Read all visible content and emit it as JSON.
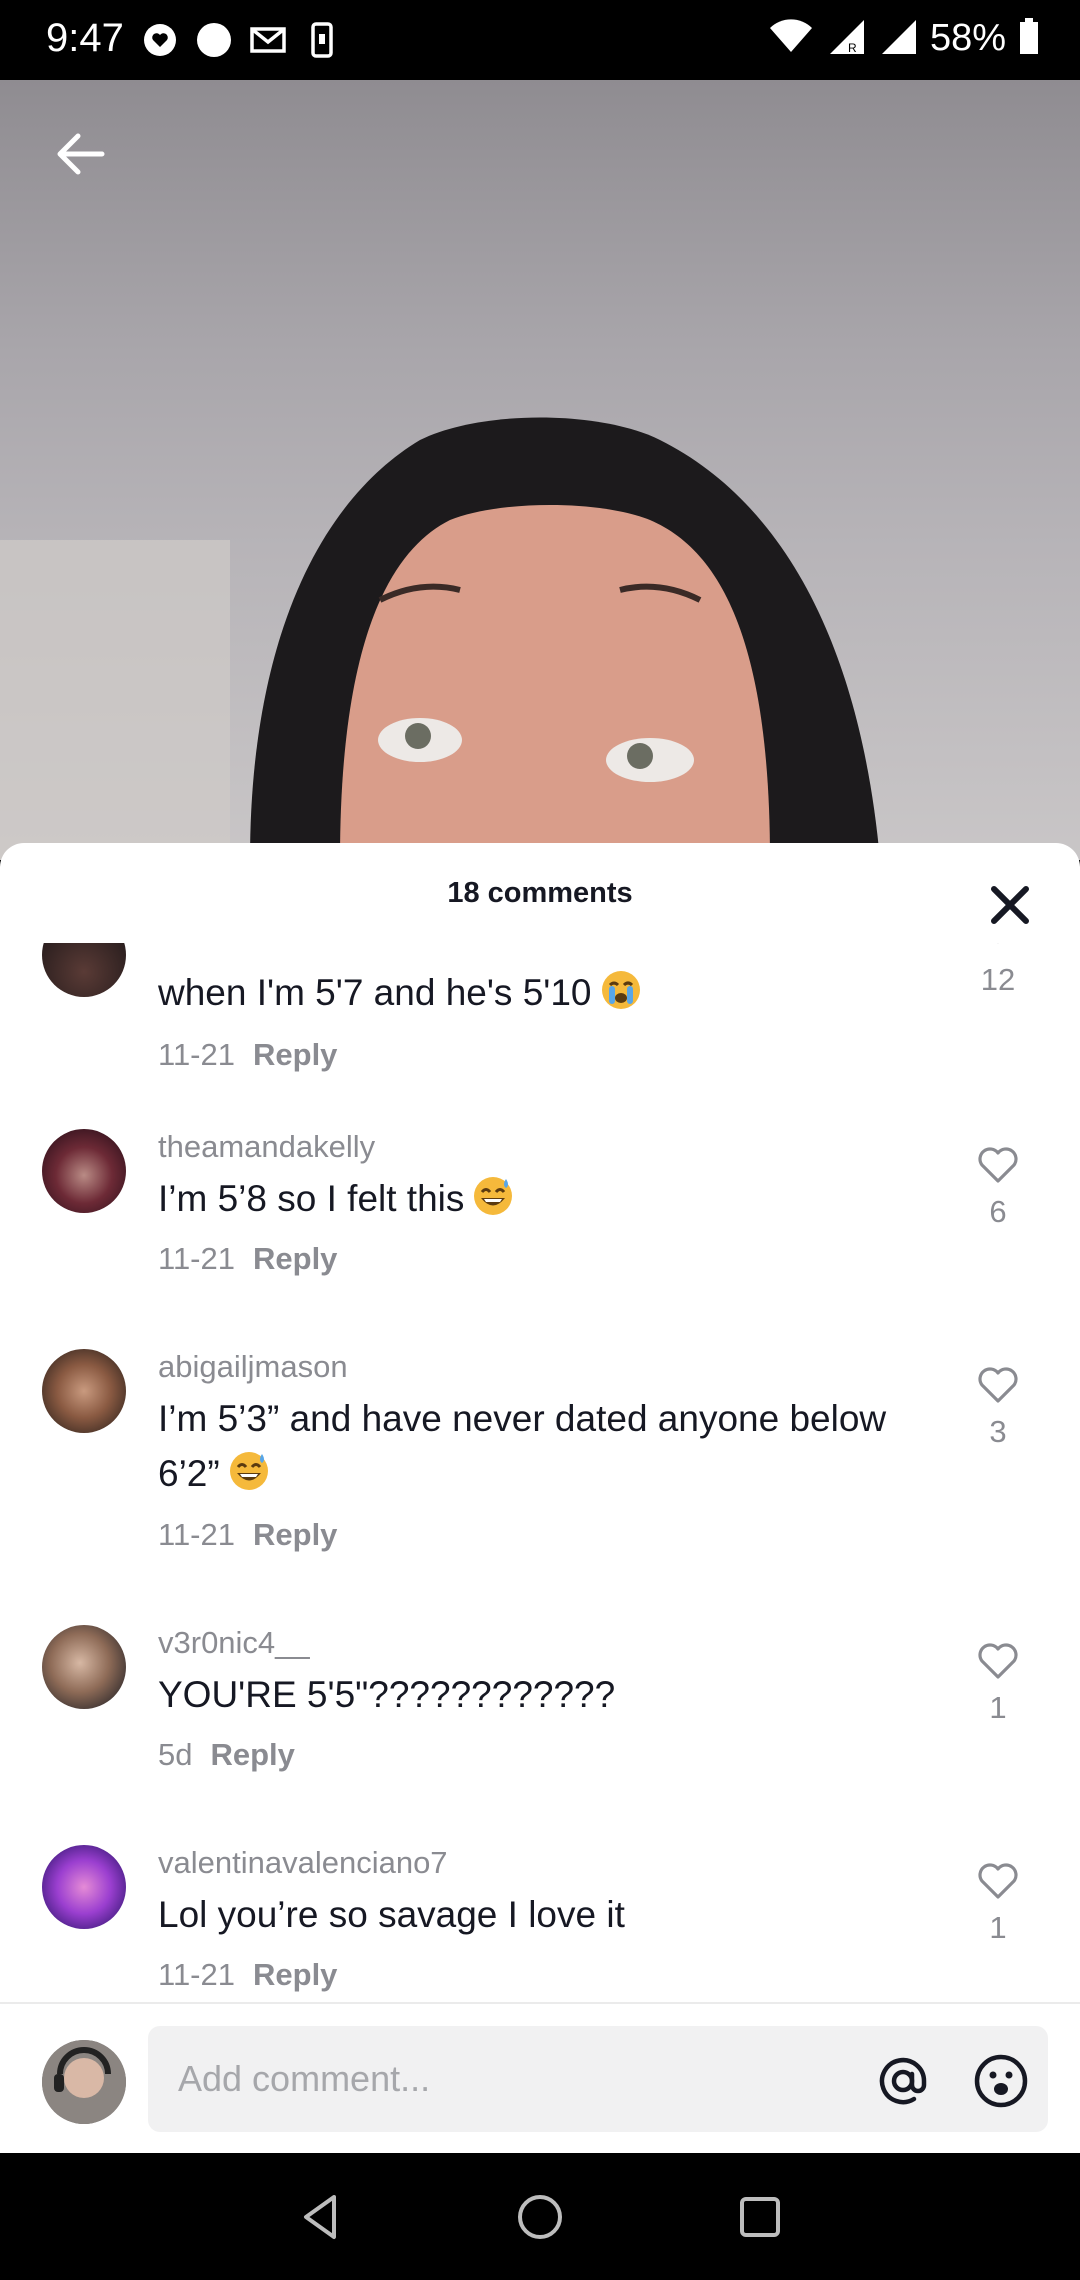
{
  "status_bar": {
    "time": "9:47",
    "battery_percent": "58%",
    "left_icons": [
      "heart-bubble-icon",
      "circle-icon",
      "gmail-icon",
      "phone-icon"
    ],
    "right_icons": [
      "wifi-icon",
      "signal-roaming-icon",
      "signal-icon",
      "battery-icon"
    ]
  },
  "video": {
    "back_icon": "arrow-left-icon"
  },
  "comments_sheet": {
    "title": "18 comments",
    "close_icon": "close-icon",
    "comments": [
      {
        "username": "",
        "text": "when I'm 5'7 and he's 5'10",
        "emoji": "loudly-crying-face",
        "date": "11-21",
        "reply_label": "Reply",
        "likes": "12",
        "like_icon": "chevron-down-icon"
      },
      {
        "username": "theamandakelly",
        "text": "I’m 5’8 so I felt this",
        "emoji": "grinning-sweat-face",
        "date": "11-21",
        "reply_label": "Reply",
        "likes": "6",
        "like_icon": "heart-outline-icon"
      },
      {
        "username": "abigailjmason",
        "text": "I’m 5’3” and have never dated anyone below 6’2”",
        "emoji": "grinning-sweat-face",
        "date": "11-21",
        "reply_label": "Reply",
        "likes": "3",
        "like_icon": "heart-outline-icon"
      },
      {
        "username": "v3r0nic4__",
        "text": "YOU'RE 5'5\"????????????",
        "emoji": "",
        "date": "5d",
        "reply_label": "Reply",
        "likes": "1",
        "like_icon": "heart-outline-icon"
      },
      {
        "username": "valentinavalenciano7",
        "text": "Lol you’re so savage I love it",
        "emoji": "",
        "date": "11-21",
        "reply_label": "Reply",
        "likes": "1",
        "like_icon": "heart-outline-icon"
      }
    ]
  },
  "input_bar": {
    "placeholder": "Add comment...",
    "value": "",
    "at_icon": "at-icon",
    "emoji_icon": "emoji-icon"
  },
  "nav_bar": {
    "icons": [
      "back-triangle-icon",
      "home-circle-icon",
      "recents-square-icon"
    ]
  },
  "colors": {
    "text_primary": "#161823",
    "text_secondary": "#8a8b91",
    "sheet_background": "#ffffff",
    "input_background": "#f1f1f2"
  }
}
